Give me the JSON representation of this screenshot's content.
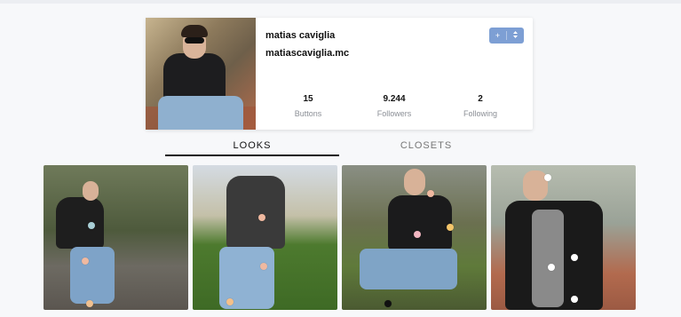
{
  "profile": {
    "name": "matias caviglia",
    "handle": "matiascaviglia.mc",
    "stats": [
      {
        "value": "15",
        "label": "Buttons"
      },
      {
        "value": "9.244",
        "label": "Followers"
      },
      {
        "value": "2",
        "label": "Following"
      }
    ],
    "action_icons": [
      "add-icon",
      "more-icon"
    ]
  },
  "tabs": [
    {
      "label": "LOOKS",
      "active": true
    },
    {
      "label": "CLOSETS",
      "active": false
    }
  ],
  "photos": [
    {
      "tag_colors": [
        "#a9cfd6",
        "#f0b9a0",
        "#f0c090"
      ]
    },
    {
      "tag_colors": [
        "#f0b9a0",
        "#f0b9a0",
        "#f5c08a"
      ]
    },
    {
      "tag_colors": [
        "#f0b9a0",
        "#f4c56a",
        "#f2b6c1",
        "#111111"
      ]
    },
    {
      "tag_colors": [
        "#ffffff",
        "#ffffff",
        "#ffffff",
        "#ffffff"
      ]
    }
  ],
  "colors": {
    "accent": "#7d9fd4",
    "active_tab_underline": "#111111"
  }
}
